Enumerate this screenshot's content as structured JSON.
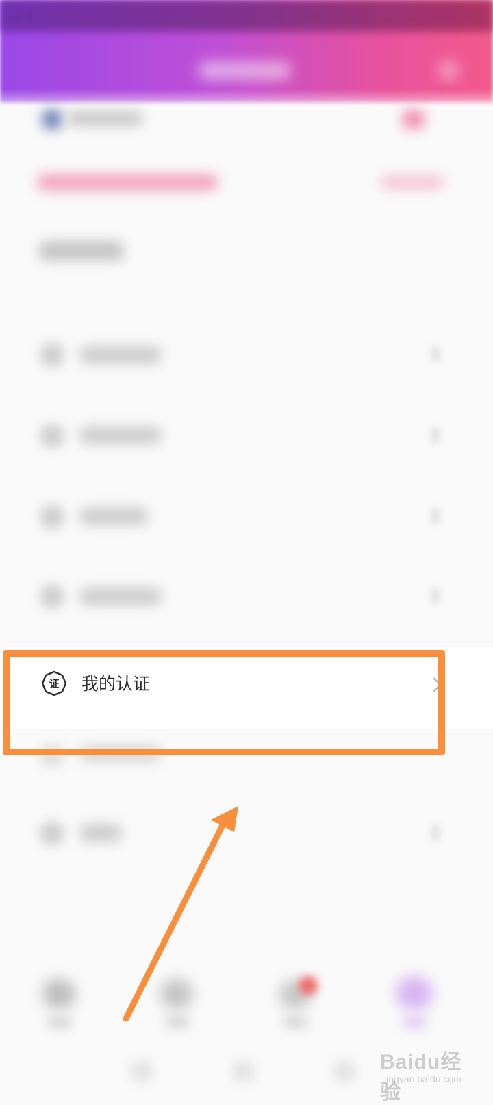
{
  "menu": {
    "certification": {
      "label": "我的认证",
      "icon": "certificate-icon",
      "icon_glyph": "证"
    }
  },
  "annotation": {
    "color": "#f98e3c"
  },
  "watermark": {
    "brand": "Baidu经验",
    "url": "jingyan.baidu.com"
  },
  "colors": {
    "header_gradient_start": "#9a48e8",
    "header_gradient_end": "#f35a8c",
    "page_background": "#fafafa"
  }
}
